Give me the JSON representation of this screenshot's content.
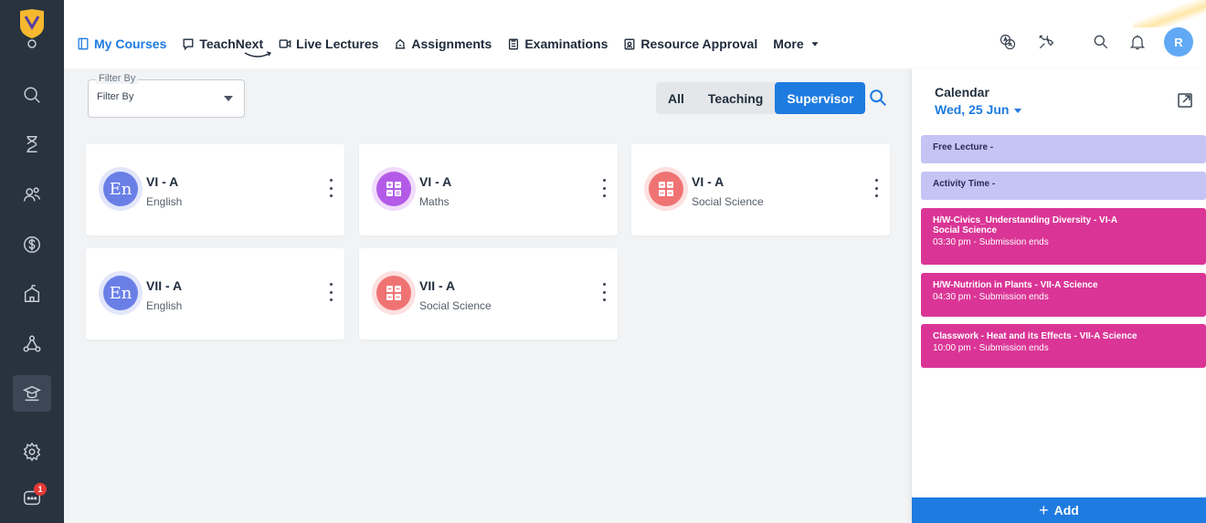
{
  "nav": {
    "items": [
      {
        "label": "My Courses",
        "icon": "book-icon"
      },
      {
        "label": "TeachNext",
        "icon": "chat-icon"
      },
      {
        "label": "Live Lectures",
        "icon": "video-icon"
      },
      {
        "label": "Assignments",
        "icon": "assignment-icon"
      },
      {
        "label": "Examinations",
        "icon": "clipboard-icon"
      },
      {
        "label": "Resource Approval",
        "icon": "approval-icon"
      },
      {
        "label": "More",
        "icon": "chevron-down-icon"
      }
    ]
  },
  "user": {
    "initial": "R"
  },
  "filter": {
    "legend": "Filter By",
    "value": "Filter By"
  },
  "segments": [
    "All",
    "Teaching",
    "Supervisor"
  ],
  "courses": [
    {
      "cls": "VI - A",
      "subject": "English",
      "icon": "En"
    },
    {
      "cls": "VI - A",
      "subject": "Maths",
      "icon": ""
    },
    {
      "cls": "VI - A",
      "subject": "Social Science",
      "icon": ""
    },
    {
      "cls": "VII - A",
      "subject": "English",
      "icon": "En"
    },
    {
      "cls": "VII - A",
      "subject": "Social Science",
      "icon": ""
    }
  ],
  "calendar": {
    "title": "Calendar",
    "date": "Wed, 25 Jun",
    "events": [
      {
        "title": "Free Lecture -"
      },
      {
        "title": "Activity Time -"
      },
      {
        "title": "H/W-Civics_Understanding Diversity - VI-A",
        "subtitle": "Social Science",
        "time": "03:30 pm - Submission ends"
      },
      {
        "title": "H/W-Nutrition in Plants - VII-A Science",
        "time": "04:30 pm - Submission ends"
      },
      {
        "title": "Classwork - Heat and its Effects - VII-A Science",
        "time": "10:00 pm - Submission ends"
      }
    ],
    "add_label": "Add"
  },
  "sidebar": {
    "chat_badge": "1"
  },
  "colors": {
    "accent": "#1e7be0",
    "sidebar": "#28333f",
    "event_light": "#c6c3f5",
    "event_pink": "#da3596"
  }
}
